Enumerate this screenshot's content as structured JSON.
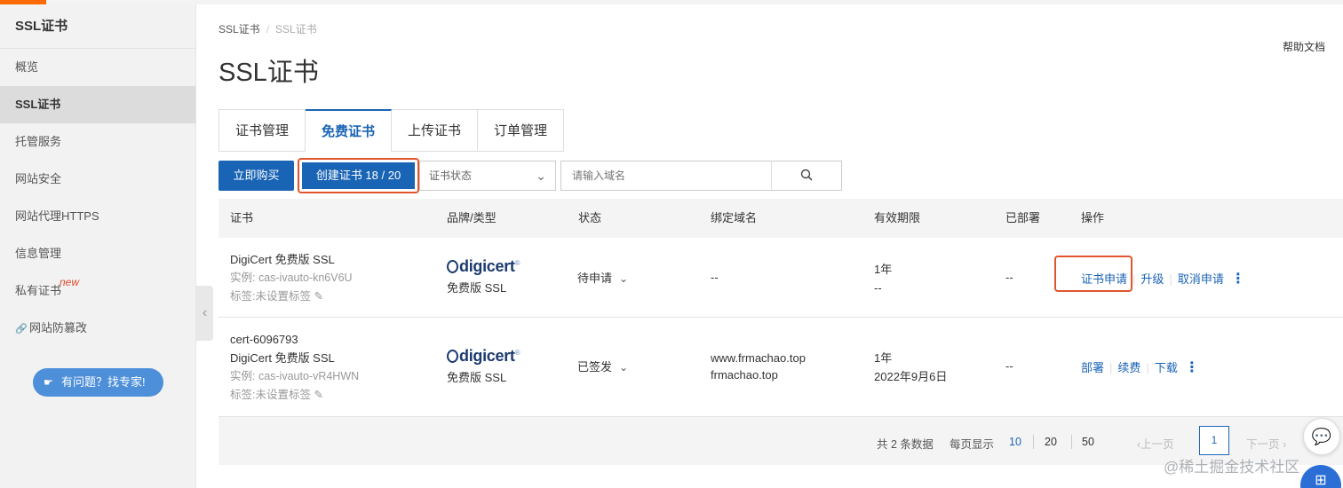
{
  "sidebar": {
    "title": "SSL证书",
    "items": [
      {
        "label": "概览"
      },
      {
        "label": "SSL证书"
      },
      {
        "label": "托管服务"
      },
      {
        "label": "网站安全"
      },
      {
        "label": "网站代理HTTPS"
      },
      {
        "label": "信息管理"
      },
      {
        "label": "私有证书",
        "badge": "new"
      },
      {
        "label": "网站防篡改"
      }
    ],
    "help_pill": "有问题？找专家!"
  },
  "breadcrumb": [
    "SSL证书",
    "SSL证书"
  ],
  "help_doc": "帮助文档",
  "page_title": "SSL证书",
  "tabs": [
    "证书管理",
    "免费证书",
    "上传证书",
    "订单管理"
  ],
  "active_tab": "免费证书",
  "toolbar": {
    "buy_label": "立即购买",
    "create_label": "创建证书 18 / 20",
    "status_select": "证书状态",
    "search_placeholder": "请输入域名"
  },
  "table": {
    "headers": [
      "证书",
      "品牌/类型",
      "状态",
      "绑定域名",
      "有效期限",
      "已部署",
      "操作"
    ],
    "rows": [
      {
        "name": "",
        "cert_type": "DigiCert 免费版 SSL",
        "instance": "实例: cas-ivauto-kn6V6U",
        "tag": "标签:未设置标签",
        "brand": "digicert",
        "brand_type": "免费版 SSL",
        "status": "待申请",
        "domains": [
          "--"
        ],
        "validity": "1年",
        "validity_end": "--",
        "deployed": "--",
        "actions": [
          "证书申请",
          "升级",
          "取消申请"
        ]
      },
      {
        "name": "cert-6096793",
        "cert_type": "DigiCert 免费版 SSL",
        "instance": "实例: cas-ivauto-vR4HWN",
        "tag": "标签:未设置标签",
        "brand": "digicert",
        "brand_type": "免费版 SSL",
        "status": "已签发",
        "domains": [
          "www.frmachao.top",
          "frmachao.top"
        ],
        "validity": "1年",
        "validity_end": "2022年9月6日",
        "deployed": "--",
        "actions": [
          "部署",
          "续费",
          "下载"
        ]
      }
    ]
  },
  "pagination": {
    "total": "共 2 条数据",
    "per_page_label": "每页显示",
    "sizes": [
      "10",
      "20",
      "50"
    ],
    "active_size": "10",
    "prev": "上一页",
    "current": "1",
    "next": "下一页"
  },
  "watermark": "@稀土掘金技术社区",
  "colors": {
    "primary": "#1a64b6",
    "highlight_box": "#e0552e",
    "accent_top": "#ff6a00",
    "new_badge": "#e8482c"
  },
  "icons": [
    "search-icon",
    "chevron-down-icon",
    "chevron-left-icon",
    "more-vertical-icon",
    "link-icon",
    "chat-icon",
    "apps-icon",
    "edit-icon"
  ]
}
